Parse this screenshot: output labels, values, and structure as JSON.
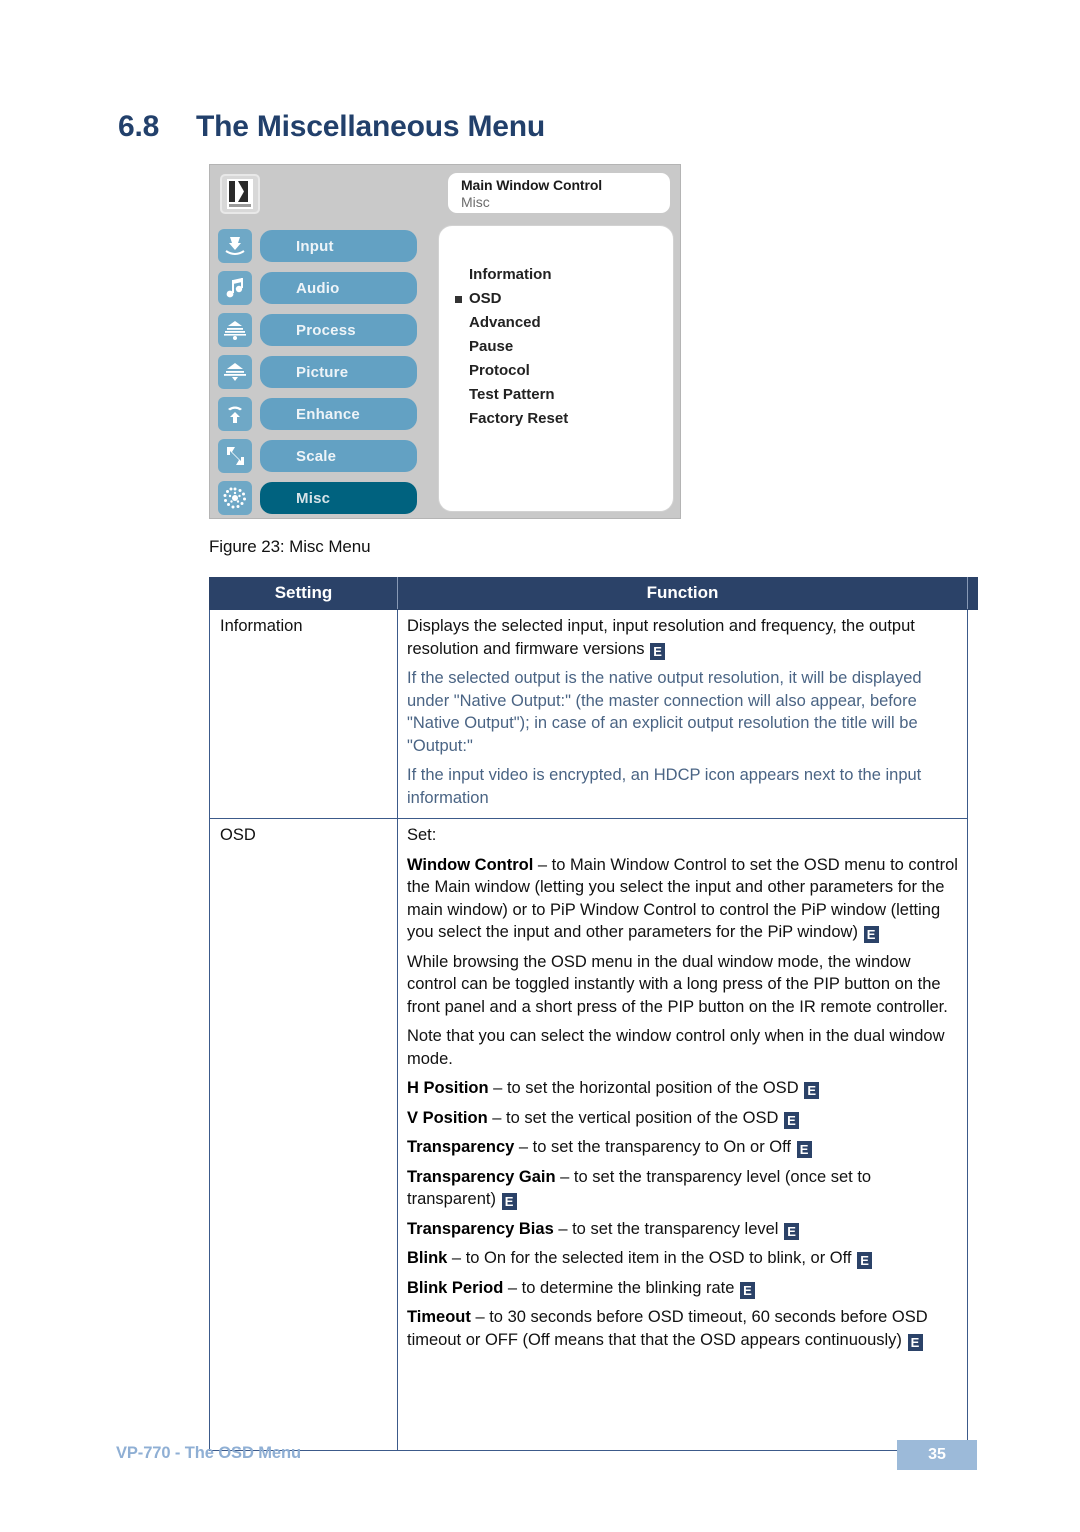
{
  "heading": {
    "number": "6.8",
    "title": "The Miscellaneous Menu"
  },
  "osd_screenshot": {
    "logo_alt": "KRAMER",
    "title_line1": "Main Window Control",
    "title_line2": "Misc",
    "menu_buttons": [
      {
        "label": "Input",
        "icon": "input-icon",
        "active": false
      },
      {
        "label": "Audio",
        "icon": "audio-note-icon",
        "active": false
      },
      {
        "label": "Process",
        "icon": "process-icon",
        "active": false
      },
      {
        "label": "Picture",
        "icon": "picture-icon",
        "active": false
      },
      {
        "label": "Enhance",
        "icon": "enhance-icon",
        "active": false
      },
      {
        "label": "Scale",
        "icon": "scale-icon",
        "active": false
      },
      {
        "label": "Misc",
        "icon": "misc-icon",
        "active": true
      }
    ],
    "submenu_items": [
      {
        "label": "Information",
        "selected": false
      },
      {
        "label": "OSD",
        "selected": true
      },
      {
        "label": "Advanced",
        "selected": false
      },
      {
        "label": "Pause",
        "selected": false
      },
      {
        "label": "Protocol",
        "selected": false
      },
      {
        "label": "Test Pattern",
        "selected": false
      },
      {
        "label": "Factory Reset",
        "selected": false
      }
    ]
  },
  "figure_caption": "Figure 23: Misc Menu",
  "table": {
    "headers": {
      "setting": "Setting",
      "function": "Function"
    },
    "rows": [
      {
        "setting": "Information",
        "paragraphs": [
          {
            "style": "black",
            "text": "Displays the selected input, input resolution and frequency, the output resolution and firmware versions ",
            "badge": "E"
          },
          {
            "style": "blue",
            "text": "If the selected output is the native output resolution, it will be displayed under \"Native Output:\" (the master connection will also appear, before \"Native Output\"); in case of an explicit output resolution the title will be \"Output:\""
          },
          {
            "style": "blue",
            "text": "If the input video is encrypted, an HDCP icon appears next to the input information"
          }
        ]
      },
      {
        "setting": "OSD",
        "paragraphs": [
          {
            "style": "black",
            "text": "Set:"
          },
          {
            "style": "black",
            "term": "Window Control",
            "text": " – to Main Window Control to set the OSD menu to control the Main window (letting you select the input and other parameters for the main window) or to PiP Window Control to control the PiP window (letting you select the input and other parameters for the PiP window) ",
            "badge": "E"
          },
          {
            "style": "black",
            "text": "While browsing the OSD menu in the dual window mode, the window control can be toggled instantly with a long press of the PIP button on the front panel and a short press of the PIP button on the IR remote controller."
          },
          {
            "style": "black",
            "text": "Note that you can select the window control only when in the dual window mode."
          },
          {
            "style": "black",
            "term": "H Position",
            "text": " – to set the horizontal position of the OSD ",
            "badge": "E"
          },
          {
            "style": "black",
            "term": "V Position",
            "text": " – to set the vertical position of the OSD ",
            "badge": "E"
          },
          {
            "style": "black",
            "term": "Transparency",
            "text": " – to set the transparency to On or Off ",
            "badge": "E"
          },
          {
            "style": "black",
            "term": "Transparency Gain",
            "text": " – to set the transparency level (once set to transparent) ",
            "badge": "E"
          },
          {
            "style": "black",
            "term": "Transparency Bias",
            "text": " – to set the transparency level ",
            "badge": "E"
          },
          {
            "style": "black",
            "term": "Blink",
            "text": " – to On for the selected item in the OSD to blink, or Off ",
            "badge": "E"
          },
          {
            "style": "black",
            "term": "Blink Period",
            "text": " – to determine the blinking rate ",
            "badge": "E"
          },
          {
            "style": "black",
            "term": "Timeout",
            "text": " – to 30 seconds before OSD timeout, 60 seconds before OSD timeout or OFF (Off means that that the OSD appears continuously) ",
            "badge": "E"
          }
        ]
      }
    ]
  },
  "footer": {
    "left_text": "VP-770 - The OSD Menu",
    "page_number": "35"
  },
  "colors": {
    "heading": "#22406B",
    "table_header_bg": "#2B4268",
    "table_border": "#3C5A8A",
    "note_text": "#4A6484",
    "menu_button": "#63A1C3",
    "menu_button_active": "#00627F",
    "footer_text": "#8FAFD4",
    "footer_page_bg": "#9CBAD9"
  }
}
